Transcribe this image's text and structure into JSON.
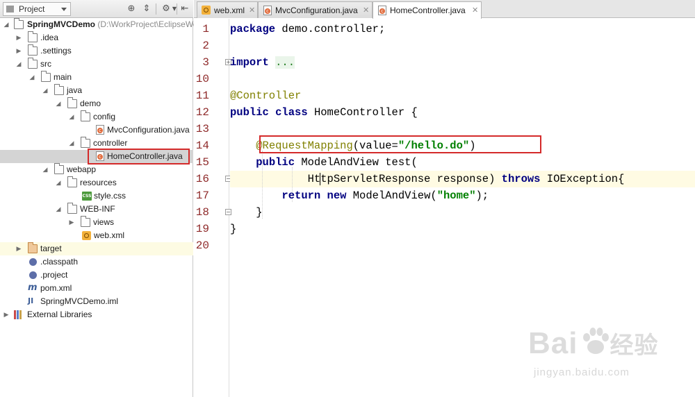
{
  "project_panel": {
    "selector_label": "Project",
    "tree": [
      {
        "label": "SpringMVCDemo",
        "path_hint": " (D:\\WorkProject\\EclipseWork",
        "bold": true
      },
      {
        "label": ".idea"
      },
      {
        "label": ".settings"
      },
      {
        "label": "src"
      },
      {
        "label": "main"
      },
      {
        "label": "java"
      },
      {
        "label": "demo"
      },
      {
        "label": "config"
      },
      {
        "label": "MvcConfiguration.java"
      },
      {
        "label": "controller"
      },
      {
        "label": "HomeController.java",
        "selected": true
      },
      {
        "label": "webapp"
      },
      {
        "label": "resources"
      },
      {
        "label": "style.css"
      },
      {
        "label": "WEB-INF"
      },
      {
        "label": "views"
      },
      {
        "label": "web.xml"
      },
      {
        "label": "target"
      },
      {
        "label": ".classpath"
      },
      {
        "label": ".project"
      },
      {
        "label": "pom.xml"
      },
      {
        "label": "SpringMVCDemo.iml"
      },
      {
        "label": "External Libraries"
      }
    ]
  },
  "editor_tabs": [
    {
      "label": "web.xml",
      "icon": "xml-file-icon",
      "active": false
    },
    {
      "label": "MvcConfiguration.java",
      "icon": "java-class-icon",
      "active": false
    },
    {
      "label": "HomeController.java",
      "icon": "java-class-icon",
      "active": true
    }
  ],
  "editor": {
    "file": "HomeController.java",
    "line_numbers": [
      "1",
      "2",
      "3",
      "10",
      "11",
      "12",
      "13",
      "14",
      "15",
      "16",
      "17",
      "18",
      "19",
      "20"
    ],
    "code": {
      "l1_kw": "package",
      "l1_rest": " demo.controller;",
      "l3_kw": "import",
      "l3_fold": "...",
      "l11_ann": "@Controller",
      "l12_kw1": "public",
      "l12_kw2": "class",
      "l12_rest": " HomeController {",
      "l14_ann": "@RequestMapping",
      "l14_open": "(value=",
      "l14_str": "\"/hello.do\"",
      "l14_close": ")",
      "l15_kw": "public",
      "l15_rest": " ModelAndView test(",
      "l16_type": "HttpServletResponse response) ",
      "l16_kw": "throws",
      "l16_rest": " IOException{",
      "l17_kw1": "return",
      "l17_kw2": "new",
      "l17_mid": " ModelAndView(",
      "l17_str": "\"home\"",
      "l17_end": ");",
      "l18": "}",
      "l19": "}"
    }
  },
  "watermark": {
    "main": "Bai",
    "main_after": "经验",
    "sub": "jingyan.baidu.com"
  },
  "colors": {
    "keyword": "#000080",
    "annotation": "#808000",
    "string": "#008000",
    "line_number": "#8e2929",
    "highlight_box": "#d42a2a",
    "current_line": "#fffbe3",
    "selected_row": "#d4d4d4"
  }
}
